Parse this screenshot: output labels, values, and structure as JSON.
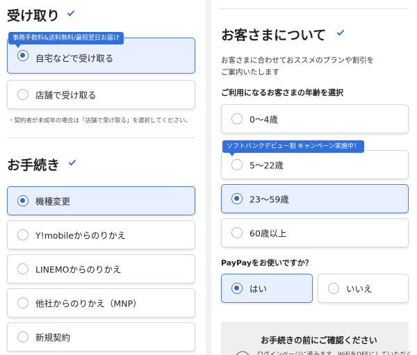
{
  "receive": {
    "title": "受け取り",
    "tag": "事務手数料&送料無料/最短翌日お届け",
    "options": [
      {
        "label": "自宅などで受け取る",
        "selected": true
      },
      {
        "label": "店舗で受け取る",
        "selected": false
      }
    ],
    "note": "・契約者が未成年の場合は「店舗で受け取る」を選択してください。"
  },
  "procedure": {
    "title": "お手続き",
    "options": [
      {
        "label": "機種変更",
        "selected": true
      },
      {
        "label": "Y!mobileからのりかえ",
        "selected": false
      },
      {
        "label": "LINEMOからのりかえ",
        "selected": false
      },
      {
        "label": "他社からのりかえ（MNP）",
        "selected": false
      },
      {
        "label": "新規契約",
        "selected": false
      }
    ]
  },
  "customer": {
    "title": "お客さまについて",
    "description_line1": "お客さまに合わせておススメのプランや割引を",
    "description_line2": "ご案内いたします",
    "age_question": "ご利用になるお客さまの年齢を選択",
    "age_tag": "ソフトバンクデビュー割 キャンペーン実施中！",
    "age_options": [
      {
        "label": "0〜4歳",
        "selected": false
      },
      {
        "label": "5〜22歳",
        "selected": false
      },
      {
        "label": "23〜59歳",
        "selected": true
      },
      {
        "label": "60歳以上",
        "selected": false
      }
    ],
    "paypay_question": "PayPayをお使いですか？",
    "paypay_options": [
      {
        "label": "はい",
        "selected": true
      },
      {
        "label": "いいえ",
        "selected": false
      }
    ]
  },
  "confirm": {
    "title": "お手続きの前にご確認ください",
    "text": "ログインページに進みます。WiFiをOFFにしていただく"
  },
  "colors": {
    "accent": "#2f6fe0",
    "selected_bg": "#e8efff",
    "divider": "#e2e2e2"
  },
  "icons": {
    "section_check": "check-icon",
    "radio": "radio-icon"
  }
}
